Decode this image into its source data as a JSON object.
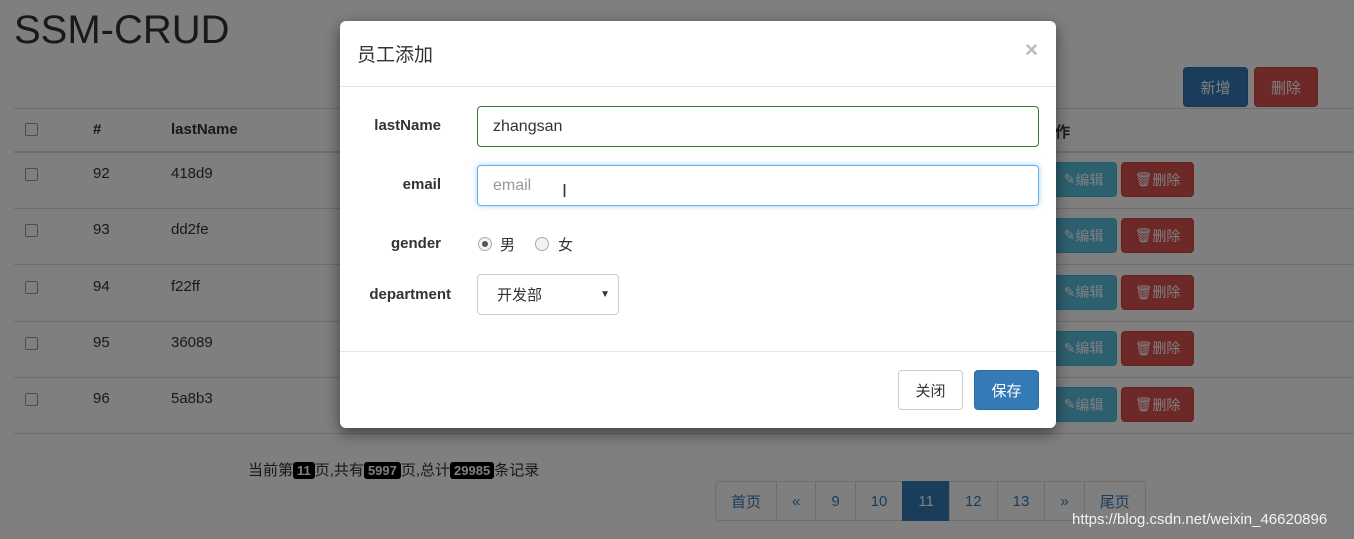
{
  "page": {
    "title": "SSM-CRUD",
    "add_label": "新增",
    "delete_label": "删除"
  },
  "table": {
    "headers": [
      "#",
      "lastName",
      "操作"
    ],
    "rows": [
      {
        "id": "92",
        "lastName": "418d9"
      },
      {
        "id": "93",
        "lastName": "dd2fe"
      },
      {
        "id": "94",
        "lastName": "f22ff"
      },
      {
        "id": "95",
        "lastName": "36089"
      },
      {
        "id": "96",
        "lastName": "5a8b3"
      }
    ],
    "edit_label": "编辑",
    "delete_label": "删除"
  },
  "pagination_info": {
    "p1": "当前第",
    "current": "11",
    "p2": "页,共有",
    "total_pages": "5997",
    "p3": "页,总计",
    "total_records": "29985",
    "p4": "条记录"
  },
  "pagination": {
    "first": "首页",
    "prev": "«",
    "pages": [
      "9",
      "10",
      "11",
      "12",
      "13"
    ],
    "active": "11",
    "next": "»",
    "last": "尾页"
  },
  "watermark": "https://blog.csdn.net/weixin_46620896",
  "modal": {
    "title": "员工添加",
    "close": "×",
    "lastName_label": "lastName",
    "lastName_value": "zhangsan",
    "email_label": "email",
    "email_placeholder": "email",
    "gender_label": "gender",
    "gender_options": [
      "男",
      "女"
    ],
    "gender_selected": "男",
    "department_label": "department",
    "department_value": "开发部",
    "cancel_label": "关闭",
    "save_label": "保存"
  }
}
